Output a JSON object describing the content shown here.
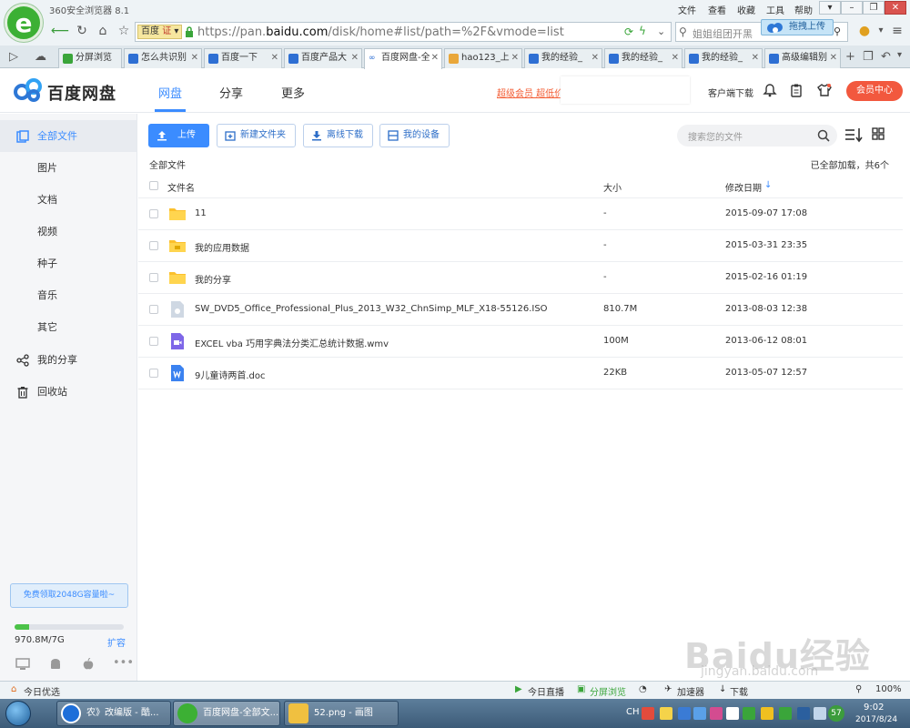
{
  "browser": {
    "title": "360安全浏览器 8.1",
    "menus": [
      "文件",
      "查看",
      "收藏",
      "工具",
      "帮助"
    ],
    "address_tag": "百度",
    "address_cert": "证",
    "url_prefix": "https://pan.",
    "url_domain": "baidu.com",
    "url_suffix": "/disk/home#list/path=%2F&vmode=list",
    "search_placeholder": "姐姐组团开黑",
    "drag_upload": "拖拽上传",
    "tabs": [
      "分屏浏览",
      "怎么共识别",
      "百度一下",
      "百度产品大",
      "百度网盘-全",
      "hao123_上",
      "我的经验_",
      "我的经验_",
      "我的经验_",
      "高级编辑别"
    ]
  },
  "header": {
    "logo_text": "百度网盘",
    "nav": [
      "网盘",
      "分享",
      "更多"
    ],
    "promo": "超级会员 超低价",
    "client_download": "客户端下载",
    "vip_center": "会员中心"
  },
  "sidebar": {
    "items": [
      "全部文件",
      "图片",
      "文档",
      "视频",
      "种子",
      "音乐",
      "其它",
      "我的分享",
      "回收站"
    ],
    "free_space": "免费领取2048G容量啦~",
    "quota_text": "970.8M/7G",
    "quota_fraction": 0.135,
    "expand": "扩容"
  },
  "toolbar": {
    "upload": "上传",
    "new_folder": "新建文件夹",
    "offline_download": "离线下载",
    "my_devices": "我的设备",
    "search_placeholder": "搜索您的文件"
  },
  "list": {
    "breadcrumb": "全部文件",
    "loaded_text": "已全部加载，共6个",
    "col_name": "文件名",
    "col_size": "大小",
    "col_date": "修改日期",
    "rows": [
      {
        "name": "11",
        "size": "-",
        "date": "2015-09-07 17:08",
        "icon": "folder-icon"
      },
      {
        "name": "我的应用数据",
        "size": "-",
        "date": "2015-03-31 23:35",
        "icon": "app-folder-icon"
      },
      {
        "name": "我的分享",
        "size": "-",
        "date": "2015-02-16 01:19",
        "icon": "folder-icon"
      },
      {
        "name": "SW_DVD5_Office_Professional_Plus_2013_W32_ChnSimp_MLF_X18-55126.ISO",
        "size": "810.7M",
        "date": "2013-08-03 12:38",
        "icon": "iso-file-icon"
      },
      {
        "name": "EXCEL vba 巧用字典法分类汇总统计数据.wmv",
        "size": "100M",
        "date": "2013-06-12 08:01",
        "icon": "video-file-icon"
      },
      {
        "name": "9儿童诗两首.doc",
        "size": "22KB",
        "date": "2013-05-07 12:57",
        "icon": "word-file-icon"
      }
    ]
  },
  "statusbar": {
    "today_pick": "今日优选",
    "today_live": "今日直播",
    "split_view": "分屏浏览",
    "accelerator": "加速器",
    "download": "下载",
    "zoom": "100%"
  },
  "taskbar": {
    "tasks": [
      "农》改编版 - 酷...",
      "百度网盘-全部文...",
      "52.png - 画图"
    ],
    "lang": "CH",
    "time": "9:02",
    "date": "2017/8/24",
    "badge": "57"
  },
  "watermark": {
    "text": "Baidu经验",
    "url": "jingyan.baidu.com"
  },
  "colors": {
    "accent": "#3b8cff",
    "vip": "#f2583e",
    "promo": "#f35b32",
    "quota": "#4bc248"
  }
}
